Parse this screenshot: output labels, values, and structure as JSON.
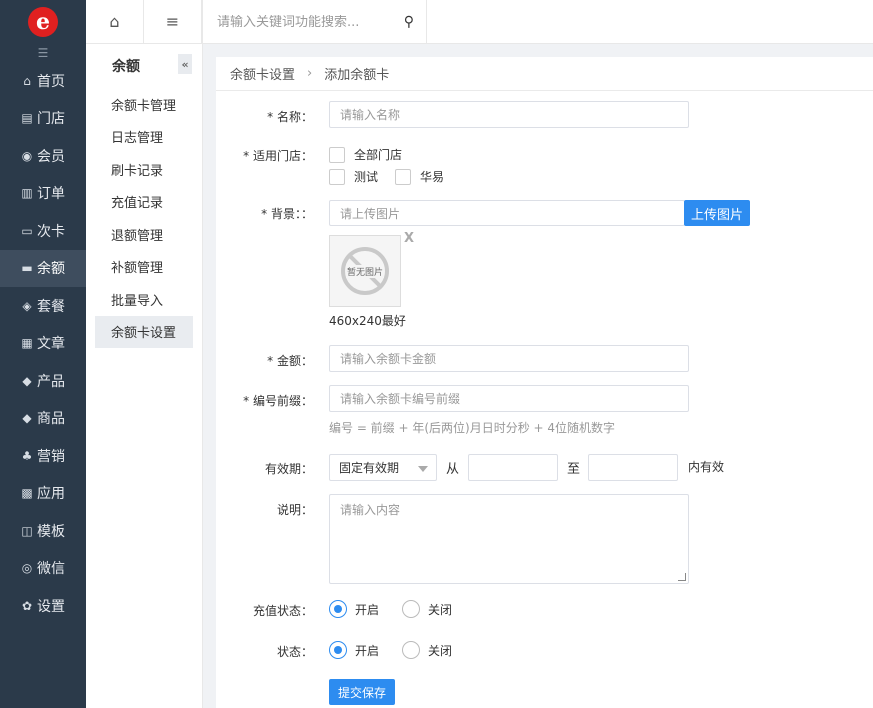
{
  "nav": {
    "items": [
      {
        "icon": "home-icon",
        "glyph": "⌂",
        "label": "首页"
      },
      {
        "icon": "store-icon",
        "glyph": "▤",
        "label": "门店"
      },
      {
        "icon": "member-icon",
        "glyph": "◉",
        "label": "会员"
      },
      {
        "icon": "order-icon",
        "glyph": "▥",
        "label": "订单"
      },
      {
        "icon": "card-icon",
        "glyph": "▭",
        "label": "次卡"
      },
      {
        "icon": "balance-icon",
        "glyph": "▬",
        "label": "余额"
      },
      {
        "icon": "package-icon",
        "glyph": "◈",
        "label": "套餐"
      },
      {
        "icon": "article-icon",
        "glyph": "▦",
        "label": "文章"
      },
      {
        "icon": "product-icon",
        "glyph": "◆",
        "label": "产品"
      },
      {
        "icon": "goods-icon",
        "glyph": "◆",
        "label": "商品"
      },
      {
        "icon": "marketing-icon",
        "glyph": "♣",
        "label": "营销"
      },
      {
        "icon": "apps-icon",
        "glyph": "▩",
        "label": "应用"
      },
      {
        "icon": "template-icon",
        "glyph": "◫",
        "label": "模板"
      },
      {
        "icon": "wechat-icon",
        "glyph": "◎",
        "label": "微信"
      },
      {
        "icon": "settings-icon",
        "glyph": "✿",
        "label": "设置"
      }
    ],
    "active_index": 5
  },
  "submenu": {
    "title": "余额",
    "items": [
      "余额卡管理",
      "日志管理",
      "刷卡记录",
      "充值记录",
      "退额管理",
      "补额管理",
      "批量导入",
      "余额卡设置"
    ],
    "active_index": 7
  },
  "topbar": {
    "search_placeholder": "请输入关键词功能搜索..."
  },
  "breadcrumb": {
    "parent": "余额卡设置",
    "separator": "›",
    "current": "添加余额卡"
  },
  "form": {
    "name_label": "* 名称：",
    "name_placeholder": "请输入名称",
    "stores_label": "* 适用门店：",
    "stores": [
      "全部门店",
      "测试",
      "华易"
    ],
    "background_label": "* 背景：：",
    "background_placeholder": "请上传图片",
    "upload_button": "上传图片",
    "no_image_text": "暂无图片",
    "remove_mark": "X",
    "size_hint": "460x240最好",
    "amount_label": "* 金额：",
    "amount_placeholder": "请输入余额卡金额",
    "prefix_label": "* 编号前缀：",
    "prefix_placeholder": "请输入余额卡编号前缀",
    "prefix_hint": "编号 = 前缀 + 年(后两位)月日时分秒 + 4位随机数字",
    "validity_label": "有效期：",
    "validity_select": "固定有效期",
    "from_text": "从",
    "to_text": "至",
    "within_text": "内有效",
    "desc_label": "说明：",
    "desc_placeholder": "请输入内容",
    "recharge_label": "充值状态：",
    "status_label": "状态：",
    "open_text": "开启",
    "close_text": "关闭",
    "submit": "提交保存"
  }
}
